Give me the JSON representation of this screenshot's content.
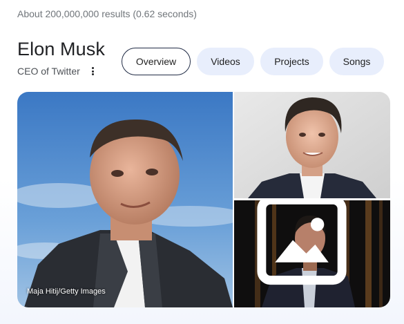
{
  "search": {
    "results_count": "About 200,000,000 results (0.62 seconds)"
  },
  "entity": {
    "title": "Elon Musk",
    "subtitle": "CEO of Twitter"
  },
  "chips": [
    {
      "label": "Overview",
      "active": true
    },
    {
      "label": "Videos",
      "active": false
    },
    {
      "label": "Projects",
      "active": false
    },
    {
      "label": "Songs",
      "active": false
    }
  ],
  "gallery": {
    "main_credit": "Maja Hitij/Getty Images",
    "images": [
      {
        "subject": "portrait-outdoor-sky"
      },
      {
        "subject": "portrait-neutral-background"
      },
      {
        "subject": "portrait-dark-stage"
      }
    ]
  },
  "icons": {
    "more": "more-vert-icon",
    "image": "image-icon"
  },
  "colors": {
    "chip_bg": "#e8eefc",
    "chip_active_border": "#1f2a44",
    "muted_text": "#70757a"
  }
}
